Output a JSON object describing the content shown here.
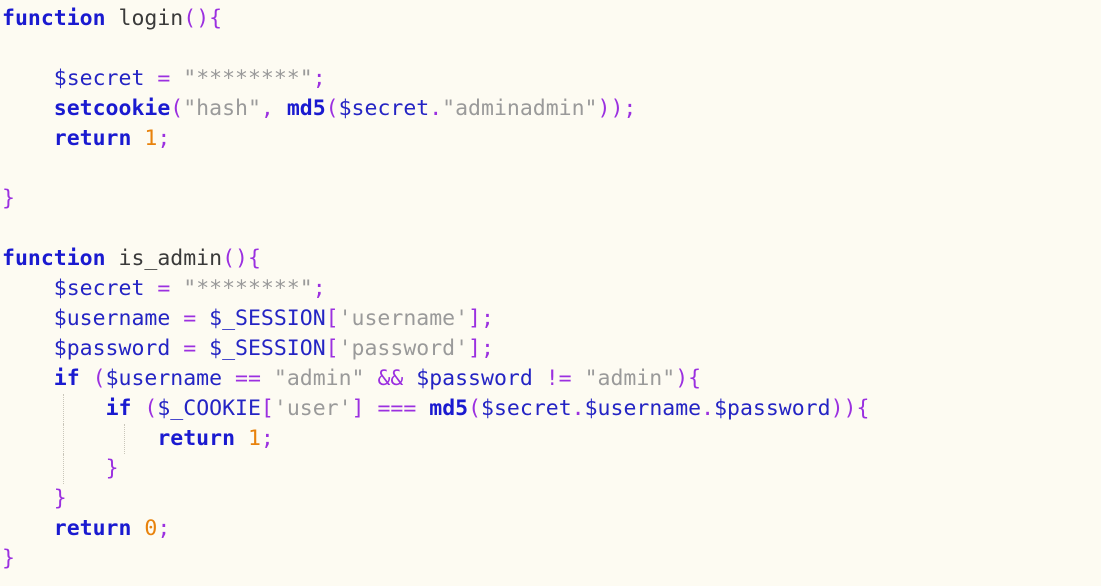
{
  "editor": {
    "language": "PHP",
    "background_color": "#fdfbf2",
    "colors": {
      "keyword": "#1a1ad0",
      "function": "#1a1ad0",
      "variable": "#2424c4",
      "string": "#9a9a9a",
      "punctuation": "#9b30e0",
      "number": "#e8820c",
      "identifier": "#3a3a3a",
      "indent_guide": "#c9c6ba"
    }
  },
  "code": {
    "lines": [
      {
        "n": 1,
        "guides": 0,
        "tokens": [
          {
            "t": "kw",
            "v": "function"
          },
          {
            "t": "plain",
            "v": " "
          },
          {
            "t": "ident",
            "v": "login"
          },
          {
            "t": "punct",
            "v": "(){"
          }
        ]
      },
      {
        "n": 2,
        "guides": 0,
        "tokens": []
      },
      {
        "n": 3,
        "guides": 0,
        "tokens": [
          {
            "t": "plain",
            "v": "    "
          },
          {
            "t": "var",
            "v": "$secret"
          },
          {
            "t": "plain",
            "v": " "
          },
          {
            "t": "op",
            "v": "="
          },
          {
            "t": "plain",
            "v": " "
          },
          {
            "t": "str",
            "v": "\"********\""
          },
          {
            "t": "punct",
            "v": ";"
          }
        ]
      },
      {
        "n": 4,
        "guides": 0,
        "tokens": [
          {
            "t": "plain",
            "v": "    "
          },
          {
            "t": "fn",
            "v": "setcookie"
          },
          {
            "t": "punct",
            "v": "("
          },
          {
            "t": "str",
            "v": "\"hash\""
          },
          {
            "t": "punct",
            "v": ","
          },
          {
            "t": "plain",
            "v": " "
          },
          {
            "t": "fn",
            "v": "md5"
          },
          {
            "t": "punct",
            "v": "("
          },
          {
            "t": "var",
            "v": "$secret"
          },
          {
            "t": "punct",
            "v": "."
          },
          {
            "t": "str",
            "v": "\"adminadmin\""
          },
          {
            "t": "punct",
            "v": "));"
          }
        ]
      },
      {
        "n": 5,
        "guides": 0,
        "tokens": [
          {
            "t": "plain",
            "v": "    "
          },
          {
            "t": "kw",
            "v": "return"
          },
          {
            "t": "plain",
            "v": " "
          },
          {
            "t": "num",
            "v": "1"
          },
          {
            "t": "punct",
            "v": ";"
          }
        ]
      },
      {
        "n": 6,
        "guides": 0,
        "tokens": []
      },
      {
        "n": 7,
        "guides": 0,
        "tokens": [
          {
            "t": "punct",
            "v": "}"
          }
        ]
      },
      {
        "n": 8,
        "guides": 0,
        "tokens": []
      },
      {
        "n": 9,
        "guides": 0,
        "tokens": [
          {
            "t": "kw",
            "v": "function"
          },
          {
            "t": "plain",
            "v": " "
          },
          {
            "t": "ident",
            "v": "is_admin"
          },
          {
            "t": "punct",
            "v": "(){"
          }
        ]
      },
      {
        "n": 10,
        "guides": 0,
        "tokens": [
          {
            "t": "plain",
            "v": "    "
          },
          {
            "t": "var",
            "v": "$secret"
          },
          {
            "t": "plain",
            "v": " "
          },
          {
            "t": "op",
            "v": "="
          },
          {
            "t": "plain",
            "v": " "
          },
          {
            "t": "str",
            "v": "\"********\""
          },
          {
            "t": "punct",
            "v": ";"
          }
        ]
      },
      {
        "n": 11,
        "guides": 0,
        "tokens": [
          {
            "t": "plain",
            "v": "    "
          },
          {
            "t": "var",
            "v": "$username"
          },
          {
            "t": "plain",
            "v": " "
          },
          {
            "t": "op",
            "v": "="
          },
          {
            "t": "plain",
            "v": " "
          },
          {
            "t": "var",
            "v": "$_SESSION"
          },
          {
            "t": "punct",
            "v": "["
          },
          {
            "t": "str",
            "v": "'username'"
          },
          {
            "t": "punct",
            "v": "];"
          }
        ]
      },
      {
        "n": 12,
        "guides": 0,
        "tokens": [
          {
            "t": "plain",
            "v": "    "
          },
          {
            "t": "var",
            "v": "$password"
          },
          {
            "t": "plain",
            "v": " "
          },
          {
            "t": "op",
            "v": "="
          },
          {
            "t": "plain",
            "v": " "
          },
          {
            "t": "var",
            "v": "$_SESSION"
          },
          {
            "t": "punct",
            "v": "["
          },
          {
            "t": "str",
            "v": "'password'"
          },
          {
            "t": "punct",
            "v": "];"
          }
        ]
      },
      {
        "n": 13,
        "guides": 0,
        "tokens": [
          {
            "t": "plain",
            "v": "    "
          },
          {
            "t": "kw",
            "v": "if"
          },
          {
            "t": "plain",
            "v": " "
          },
          {
            "t": "punct",
            "v": "("
          },
          {
            "t": "var",
            "v": "$username"
          },
          {
            "t": "plain",
            "v": " "
          },
          {
            "t": "op",
            "v": "=="
          },
          {
            "t": "plain",
            "v": " "
          },
          {
            "t": "str",
            "v": "\"admin\""
          },
          {
            "t": "plain",
            "v": " "
          },
          {
            "t": "op",
            "v": "&&"
          },
          {
            "t": "plain",
            "v": " "
          },
          {
            "t": "var",
            "v": "$password"
          },
          {
            "t": "plain",
            "v": " "
          },
          {
            "t": "op",
            "v": "!="
          },
          {
            "t": "plain",
            "v": " "
          },
          {
            "t": "str",
            "v": "\"admin\""
          },
          {
            "t": "punct",
            "v": "){"
          }
        ]
      },
      {
        "n": 14,
        "guides": 1,
        "tokens": [
          {
            "t": "plain",
            "v": "        "
          },
          {
            "t": "kw",
            "v": "if"
          },
          {
            "t": "plain",
            "v": " "
          },
          {
            "t": "punct",
            "v": "("
          },
          {
            "t": "var",
            "v": "$_COOKIE"
          },
          {
            "t": "punct",
            "v": "["
          },
          {
            "t": "str",
            "v": "'user'"
          },
          {
            "t": "punct",
            "v": "]"
          },
          {
            "t": "plain",
            "v": " "
          },
          {
            "t": "op",
            "v": "==="
          },
          {
            "t": "plain",
            "v": " "
          },
          {
            "t": "fn",
            "v": "md5"
          },
          {
            "t": "punct",
            "v": "("
          },
          {
            "t": "var",
            "v": "$secret"
          },
          {
            "t": "punct",
            "v": "."
          },
          {
            "t": "var",
            "v": "$username"
          },
          {
            "t": "punct",
            "v": "."
          },
          {
            "t": "var",
            "v": "$password"
          },
          {
            "t": "punct",
            "v": ")){"
          }
        ]
      },
      {
        "n": 15,
        "guides": 2,
        "tokens": [
          {
            "t": "plain",
            "v": "            "
          },
          {
            "t": "kw",
            "v": "return"
          },
          {
            "t": "plain",
            "v": " "
          },
          {
            "t": "num",
            "v": "1"
          },
          {
            "t": "punct",
            "v": ";"
          }
        ]
      },
      {
        "n": 16,
        "guides": 1,
        "tokens": [
          {
            "t": "plain",
            "v": "        "
          },
          {
            "t": "punct",
            "v": "}"
          }
        ]
      },
      {
        "n": 17,
        "guides": 0,
        "tokens": [
          {
            "t": "plain",
            "v": "    "
          },
          {
            "t": "punct",
            "v": "}"
          }
        ]
      },
      {
        "n": 18,
        "guides": 0,
        "tokens": [
          {
            "t": "plain",
            "v": "    "
          },
          {
            "t": "kw",
            "v": "return"
          },
          {
            "t": "plain",
            "v": " "
          },
          {
            "t": "num",
            "v": "0"
          },
          {
            "t": "punct",
            "v": ";"
          }
        ]
      },
      {
        "n": 19,
        "guides": 0,
        "tokens": [
          {
            "t": "punct",
            "v": "}"
          }
        ]
      }
    ]
  }
}
